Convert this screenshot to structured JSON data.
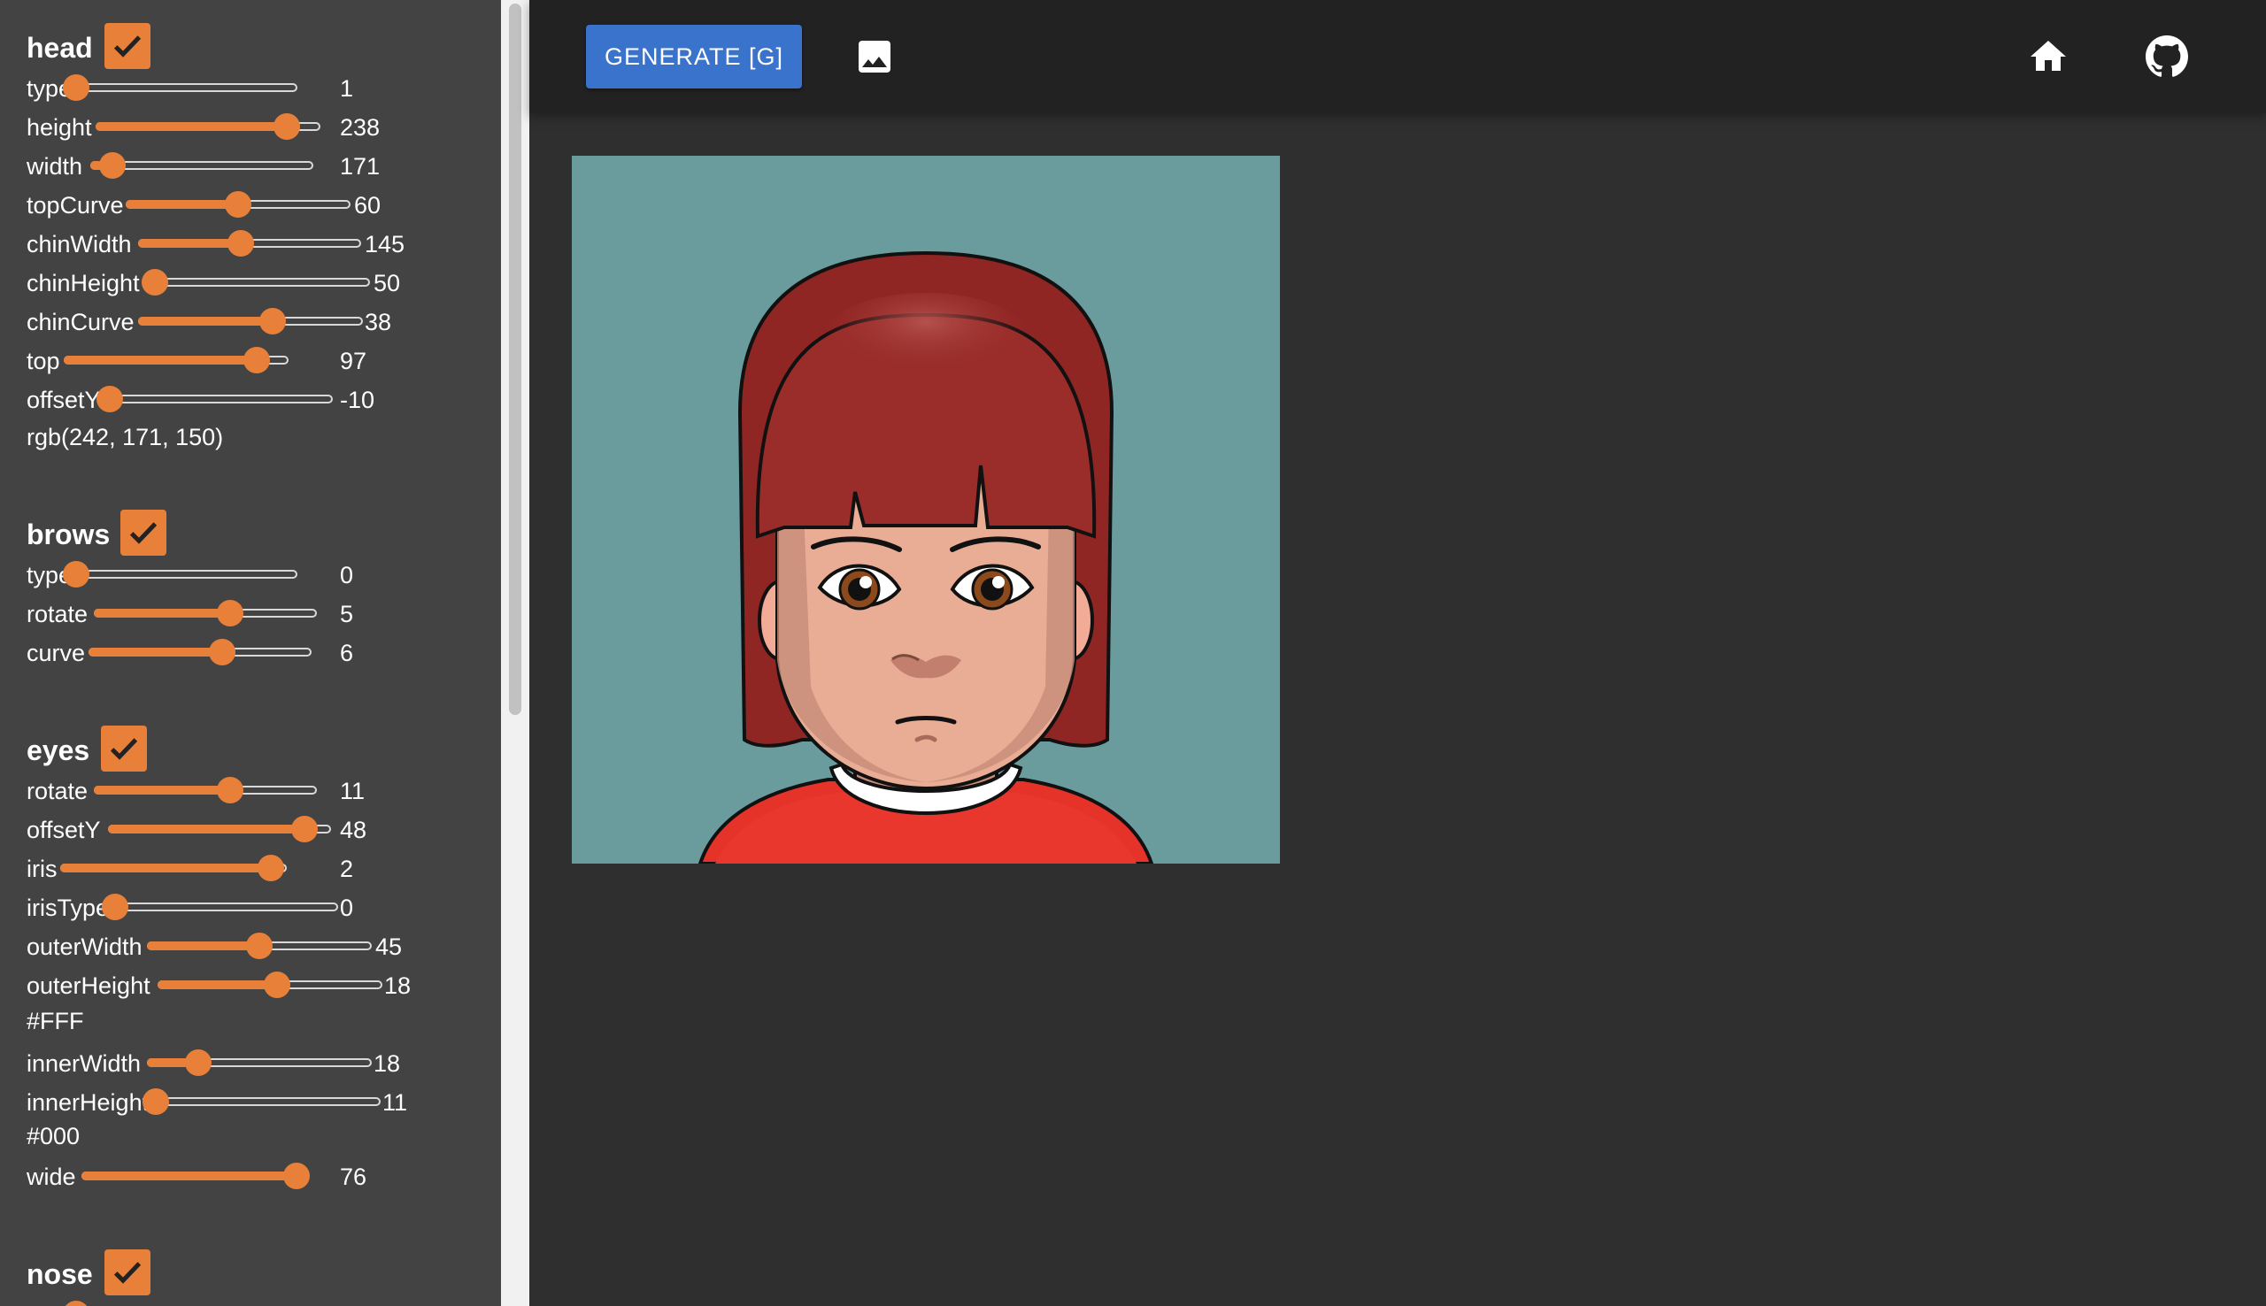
{
  "toolbar": {
    "generate_label": "GENERATE [G]",
    "icons": [
      "image-icon",
      "home-icon",
      "github-icon"
    ]
  },
  "colors": {
    "accent": "#e8803a",
    "button": "#3a73cc",
    "sidebar_bg": "#434343",
    "topbar_bg": "#222222",
    "canvas_bg": "#6b9c9d"
  },
  "sections": {
    "head": {
      "title": "head",
      "checked": true,
      "controls": [
        {
          "label": "type",
          "value": "1",
          "fraction": 0.0
        },
        {
          "label": "height",
          "value": "238",
          "fraction": 0.85
        },
        {
          "label": "width",
          "value": "171",
          "fraction": 0.1
        },
        {
          "label": "topCurve",
          "value": "60",
          "fraction": 0.5
        },
        {
          "label": "chinWidth",
          "value": "145",
          "fraction": 0.46
        },
        {
          "label": "chinHeight",
          "value": "50",
          "fraction": 0.05
        },
        {
          "label": "chinCurve",
          "value": "38",
          "fraction": 0.6
        },
        {
          "label": "top",
          "value": "97",
          "fraction": 0.86
        },
        {
          "label": "offsetY",
          "value": "-10",
          "fraction": 0.0
        }
      ],
      "color": "rgb(242, 171, 150)"
    },
    "brows": {
      "title": "brows",
      "checked": true,
      "controls": [
        {
          "label": "type",
          "value": "0",
          "fraction": 0.0
        },
        {
          "label": "rotate",
          "value": "5",
          "fraction": 0.61
        },
        {
          "label": "curve",
          "value": "6",
          "fraction": 0.6
        }
      ]
    },
    "eyes": {
      "title": "eyes",
      "checked": true,
      "controls": [
        {
          "label": "rotate",
          "value": "11",
          "fraction": 0.61
        },
        {
          "label": "offsetY",
          "value": "48",
          "fraction": 0.88
        },
        {
          "label": "iris",
          "value": "2",
          "fraction": 0.93
        },
        {
          "label": "irisType",
          "value": "0",
          "fraction": 0.0
        },
        {
          "label": "outerWidth",
          "value": "45",
          "fraction": 0.5
        },
        {
          "label": "outerHeight",
          "value": "18",
          "fraction": 0.53
        }
      ],
      "outer_color": "#FFF",
      "inner_controls": [
        {
          "label": "innerWidth",
          "value": "18",
          "fraction": 0.23
        },
        {
          "label": "innerHeight",
          "value": "11",
          "fraction": 0.0
        }
      ],
      "inner_color": "#000",
      "wide_control": {
        "label": "wide",
        "value": "76",
        "fraction": 0.97
      }
    },
    "nose": {
      "title": "nose",
      "checked": true
    }
  }
}
